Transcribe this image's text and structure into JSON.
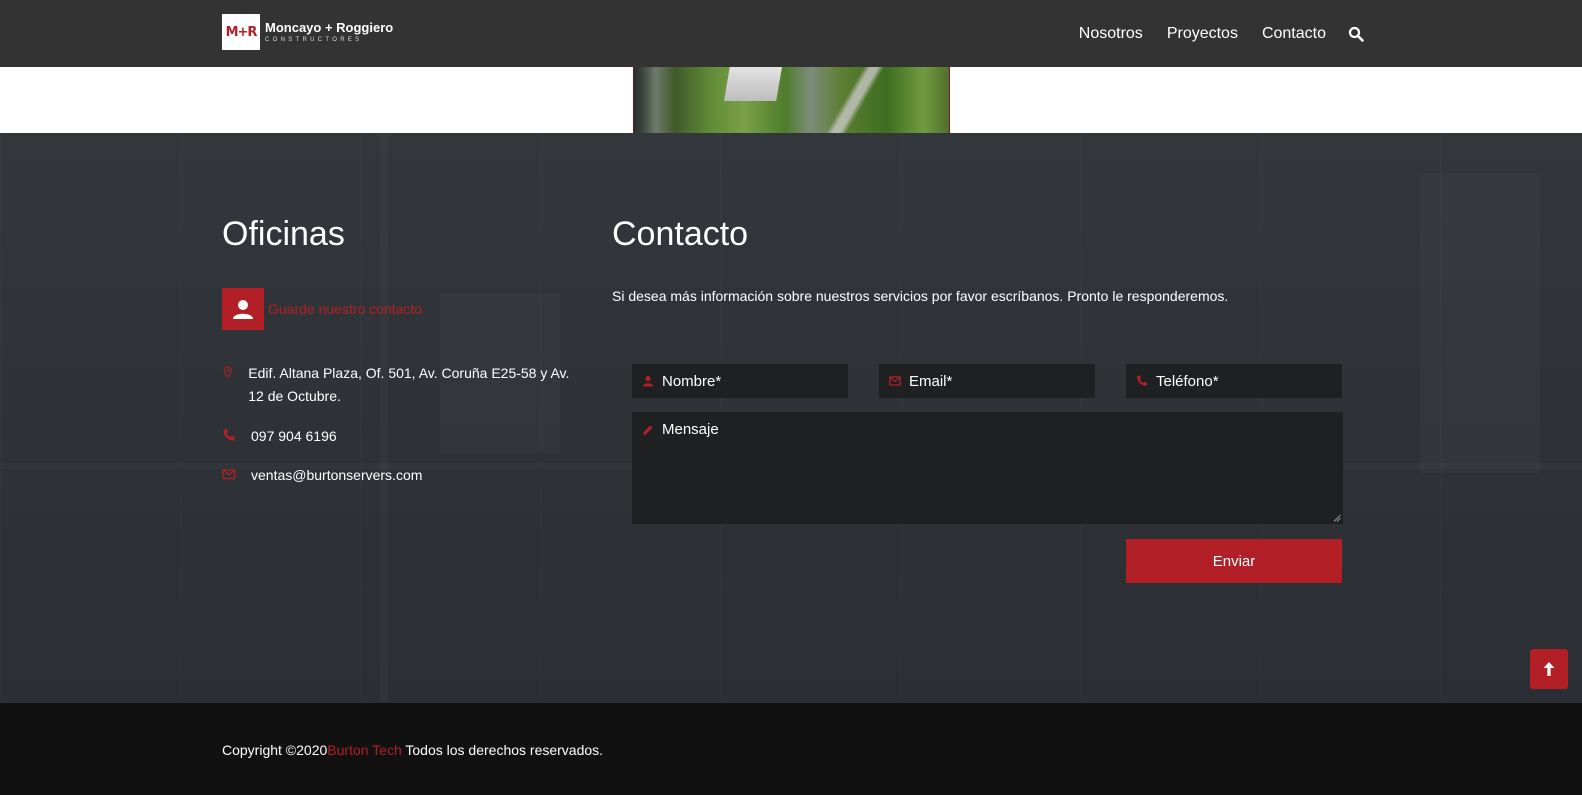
{
  "header": {
    "logo_mark": "M+R",
    "logo_name": "Moncayo + Roggiero",
    "logo_sub": "CONSTRUCTORES",
    "nav": [
      {
        "label": "Nosotros"
      },
      {
        "label": "Proyectos"
      },
      {
        "label": "Contacto"
      }
    ]
  },
  "offices": {
    "title": "Oficinas",
    "save_contact": "Guarde nuestro contacto",
    "address": "Edif. Altana Plaza, Of. 501, Av. Coruña E25-58 y Av. 12 de Octubre.",
    "phone": "097 904 6196",
    "email": "ventas@burtonservers.com"
  },
  "contact": {
    "title": "Contacto",
    "intro": "Si desea más información sobre nuestros servicios por favor escríbanos. Pronto le responderemos.",
    "fields": {
      "name_placeholder": "Nombre*",
      "email_placeholder": "Email*",
      "phone_placeholder": "Teléfono*",
      "message_placeholder": "Mensaje"
    },
    "submit_label": "Enviar"
  },
  "footer": {
    "copyright_prefix": "Copyright ©2020",
    "brand": "Burton Tech",
    "copyright_suffix": " Todos los derechos reservados."
  },
  "icons": {
    "search": "search-icon",
    "person": "user-icon",
    "location": "map-pin-icon",
    "phone": "phone-icon",
    "mail": "mail-icon",
    "pencil": "pencil-icon",
    "arrow_up": "arrow-up-icon"
  },
  "colors": {
    "accent": "#b21f27",
    "header_bg": "#333333",
    "footer_bg": "#111111",
    "field_bg": "#1e2022"
  }
}
